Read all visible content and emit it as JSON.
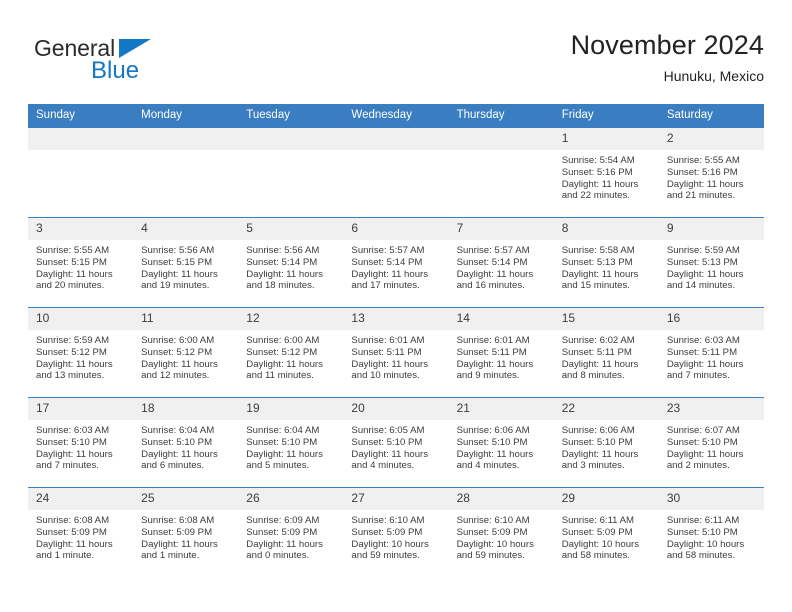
{
  "brand": {
    "name_part1": "General",
    "name_part2": "Blue",
    "triangle_icon": "triangle-icon",
    "accent_color": "#1277c4"
  },
  "header": {
    "month_title": "November 2024",
    "location": "Hunuku, Mexico"
  },
  "theme": {
    "header_blue": "#3b7dc1",
    "daynum_gray": "#f0f0f0",
    "text": "#3d3d3d"
  },
  "calendar": {
    "weekday_headers": [
      "Sunday",
      "Monday",
      "Tuesday",
      "Wednesday",
      "Thursday",
      "Friday",
      "Saturday"
    ],
    "weeks": [
      [
        {
          "day": "",
          "lines": ""
        },
        {
          "day": "",
          "lines": ""
        },
        {
          "day": "",
          "lines": ""
        },
        {
          "day": "",
          "lines": ""
        },
        {
          "day": "",
          "lines": ""
        },
        {
          "day": "1",
          "lines": "Sunrise: 5:54 AM\nSunset: 5:16 PM\nDaylight: 11 hours\nand 22 minutes."
        },
        {
          "day": "2",
          "lines": "Sunrise: 5:55 AM\nSunset: 5:16 PM\nDaylight: 11 hours\nand 21 minutes."
        }
      ],
      [
        {
          "day": "3",
          "lines": "Sunrise: 5:55 AM\nSunset: 5:15 PM\nDaylight: 11 hours\nand 20 minutes."
        },
        {
          "day": "4",
          "lines": "Sunrise: 5:56 AM\nSunset: 5:15 PM\nDaylight: 11 hours\nand 19 minutes."
        },
        {
          "day": "5",
          "lines": "Sunrise: 5:56 AM\nSunset: 5:14 PM\nDaylight: 11 hours\nand 18 minutes."
        },
        {
          "day": "6",
          "lines": "Sunrise: 5:57 AM\nSunset: 5:14 PM\nDaylight: 11 hours\nand 17 minutes."
        },
        {
          "day": "7",
          "lines": "Sunrise: 5:57 AM\nSunset: 5:14 PM\nDaylight: 11 hours\nand 16 minutes."
        },
        {
          "day": "8",
          "lines": "Sunrise: 5:58 AM\nSunset: 5:13 PM\nDaylight: 11 hours\nand 15 minutes."
        },
        {
          "day": "9",
          "lines": "Sunrise: 5:59 AM\nSunset: 5:13 PM\nDaylight: 11 hours\nand 14 minutes."
        }
      ],
      [
        {
          "day": "10",
          "lines": "Sunrise: 5:59 AM\nSunset: 5:12 PM\nDaylight: 11 hours\nand 13 minutes."
        },
        {
          "day": "11",
          "lines": "Sunrise: 6:00 AM\nSunset: 5:12 PM\nDaylight: 11 hours\nand 12 minutes."
        },
        {
          "day": "12",
          "lines": "Sunrise: 6:00 AM\nSunset: 5:12 PM\nDaylight: 11 hours\nand 11 minutes."
        },
        {
          "day": "13",
          "lines": "Sunrise: 6:01 AM\nSunset: 5:11 PM\nDaylight: 11 hours\nand 10 minutes."
        },
        {
          "day": "14",
          "lines": "Sunrise: 6:01 AM\nSunset: 5:11 PM\nDaylight: 11 hours\nand 9 minutes."
        },
        {
          "day": "15",
          "lines": "Sunrise: 6:02 AM\nSunset: 5:11 PM\nDaylight: 11 hours\nand 8 minutes."
        },
        {
          "day": "16",
          "lines": "Sunrise: 6:03 AM\nSunset: 5:11 PM\nDaylight: 11 hours\nand 7 minutes."
        }
      ],
      [
        {
          "day": "17",
          "lines": "Sunrise: 6:03 AM\nSunset: 5:10 PM\nDaylight: 11 hours\nand 7 minutes."
        },
        {
          "day": "18",
          "lines": "Sunrise: 6:04 AM\nSunset: 5:10 PM\nDaylight: 11 hours\nand 6 minutes."
        },
        {
          "day": "19",
          "lines": "Sunrise: 6:04 AM\nSunset: 5:10 PM\nDaylight: 11 hours\nand 5 minutes."
        },
        {
          "day": "20",
          "lines": "Sunrise: 6:05 AM\nSunset: 5:10 PM\nDaylight: 11 hours\nand 4 minutes."
        },
        {
          "day": "21",
          "lines": "Sunrise: 6:06 AM\nSunset: 5:10 PM\nDaylight: 11 hours\nand 4 minutes."
        },
        {
          "day": "22",
          "lines": "Sunrise: 6:06 AM\nSunset: 5:10 PM\nDaylight: 11 hours\nand 3 minutes."
        },
        {
          "day": "23",
          "lines": "Sunrise: 6:07 AM\nSunset: 5:10 PM\nDaylight: 11 hours\nand 2 minutes."
        }
      ],
      [
        {
          "day": "24",
          "lines": "Sunrise: 6:08 AM\nSunset: 5:09 PM\nDaylight: 11 hours\nand 1 minute."
        },
        {
          "day": "25",
          "lines": "Sunrise: 6:08 AM\nSunset: 5:09 PM\nDaylight: 11 hours\nand 1 minute."
        },
        {
          "day": "26",
          "lines": "Sunrise: 6:09 AM\nSunset: 5:09 PM\nDaylight: 11 hours\nand 0 minutes."
        },
        {
          "day": "27",
          "lines": "Sunrise: 6:10 AM\nSunset: 5:09 PM\nDaylight: 10 hours\nand 59 minutes."
        },
        {
          "day": "28",
          "lines": "Sunrise: 6:10 AM\nSunset: 5:09 PM\nDaylight: 10 hours\nand 59 minutes."
        },
        {
          "day": "29",
          "lines": "Sunrise: 6:11 AM\nSunset: 5:09 PM\nDaylight: 10 hours\nand 58 minutes."
        },
        {
          "day": "30",
          "lines": "Sunrise: 6:11 AM\nSunset: 5:10 PM\nDaylight: 10 hours\nand 58 minutes."
        }
      ]
    ]
  }
}
